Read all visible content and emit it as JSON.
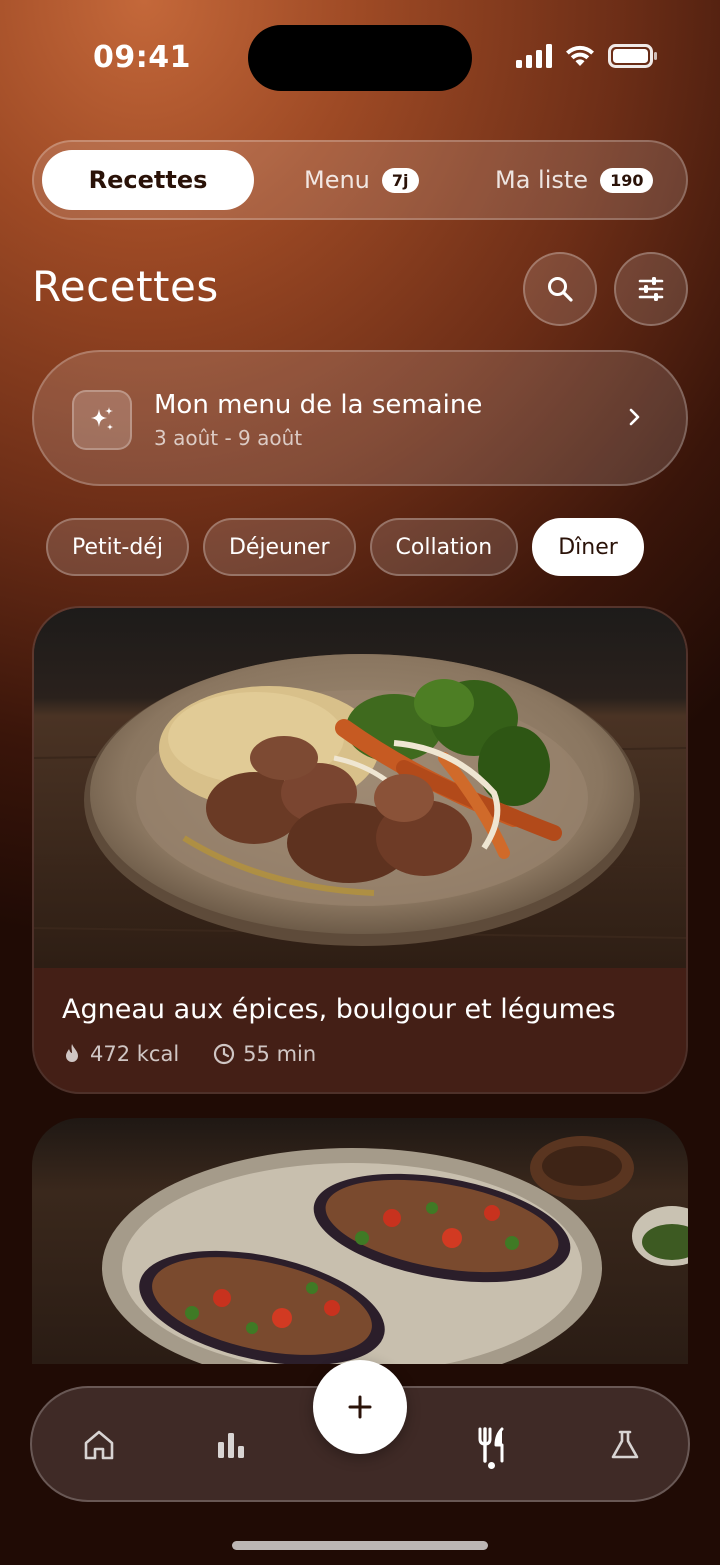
{
  "status": {
    "time": "09:41"
  },
  "tabs": {
    "recettes": "Recettes",
    "menu": "Menu",
    "menu_badge": "7j",
    "liste": "Ma liste",
    "liste_badge": "190"
  },
  "header": {
    "title": "Recettes"
  },
  "week": {
    "title": "Mon menu de la semaine",
    "dates": "3 août - 9 août"
  },
  "filters": [
    "Petit-déj",
    "Déjeuner",
    "Collation",
    "Dîner"
  ],
  "active_filter": "Dîner",
  "recipes": [
    {
      "title": "Agneau aux épices, boulgour et légumes",
      "kcal": "472 kcal",
      "time": "55 min"
    }
  ],
  "nav": {
    "items": [
      "home-icon",
      "stats-icon",
      "add-icon",
      "recipes-icon",
      "lab-icon"
    ],
    "active": "recipes-icon"
  }
}
